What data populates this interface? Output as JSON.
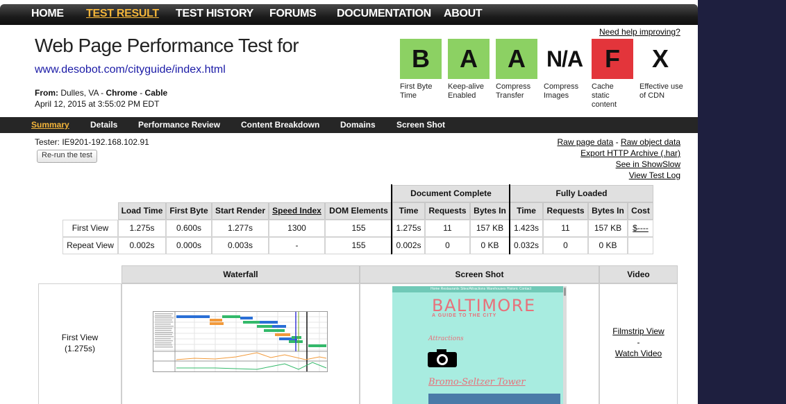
{
  "nav": {
    "items": [
      "HOME",
      "TEST RESULT",
      "TEST HISTORY",
      "FORUMS",
      "DOCUMENTATION",
      "ABOUT"
    ]
  },
  "header": {
    "title": "Web Page Performance Test for",
    "url": "www.desobot.com/cityguide/index.html",
    "from_label": "From:",
    "from_location": "Dulles, VA -",
    "browser": "Chrome",
    "sep": "-",
    "connection": "Cable",
    "date": "April 12, 2015 at 3:55:02 PM EDT",
    "help_link": "Need help improving?"
  },
  "grades": [
    {
      "grade": "B",
      "label": "First Byte Time",
      "color": "#8cd163"
    },
    {
      "grade": "A",
      "label": "Keep-alive Enabled",
      "color": "#8cd163"
    },
    {
      "grade": "A",
      "label": "Compress Transfer",
      "color": "#8cd163"
    },
    {
      "grade": "N/A",
      "label": "Compress Images",
      "color": "none"
    },
    {
      "grade": "F",
      "label": "Cache static content",
      "color": "#e3353b"
    },
    {
      "grade": "X",
      "label": "Effective use of CDN",
      "color": "none"
    }
  ],
  "subnav": {
    "items": [
      "Summary",
      "Details",
      "Performance Review",
      "Content Breakdown",
      "Domains",
      "Screen Shot"
    ]
  },
  "tester": "Tester: IE9201-192.168.102.91",
  "rerun_label": "Re-run the test",
  "right_links": [
    "Raw page data",
    "-",
    "Raw object data",
    "Export HTTP Archive (.har)",
    "See in ShowSlow",
    "View Test Log"
  ],
  "results": {
    "group_headers": [
      "Document Complete",
      "Fully Loaded"
    ],
    "columns": [
      "Load Time",
      "First Byte",
      "Start Render",
      "Speed Index",
      "DOM Elements",
      "Time",
      "Requests",
      "Bytes In",
      "Time",
      "Requests",
      "Bytes In",
      "Cost"
    ],
    "rows": [
      {
        "label": "First View",
        "values": [
          "1.275s",
          "0.600s",
          "1.277s",
          "1300",
          "155",
          "1.275s",
          "11",
          "157 KB",
          "1.423s",
          "11",
          "157 KB",
          "$----"
        ]
      },
      {
        "label": "Repeat View",
        "values": [
          "0.002s",
          "0.000s",
          "0.003s",
          "-",
          "155",
          "0.002s",
          "0",
          "0 KB",
          "0.032s",
          "0",
          "0 KB",
          ""
        ]
      }
    ]
  },
  "media": {
    "headers": [
      "Waterfall",
      "Screen Shot",
      "Video"
    ],
    "row_label": "First View",
    "row_time": "(1.275s)",
    "filmstrip_link": "Filmstrip View",
    "dash": "-",
    "watch_link": "Watch Video",
    "screenshot": {
      "nav_text": "Home  Restaurants  Sites/Attractions  Warehouses  Historic  Contact",
      "city": "BALTIMORE",
      "tagline": "A GUIDE TO THE CITY",
      "section": "Attractions",
      "place": "Bromo-Seltzer Tower"
    }
  },
  "colors": {
    "accent": "#f5b63a",
    "grade_good": "#8cd163",
    "grade_bad": "#e3353b",
    "link": "#1a1aa6",
    "screenshot_bg": "#a8ece0",
    "screenshot_text": "#e8707a"
  }
}
